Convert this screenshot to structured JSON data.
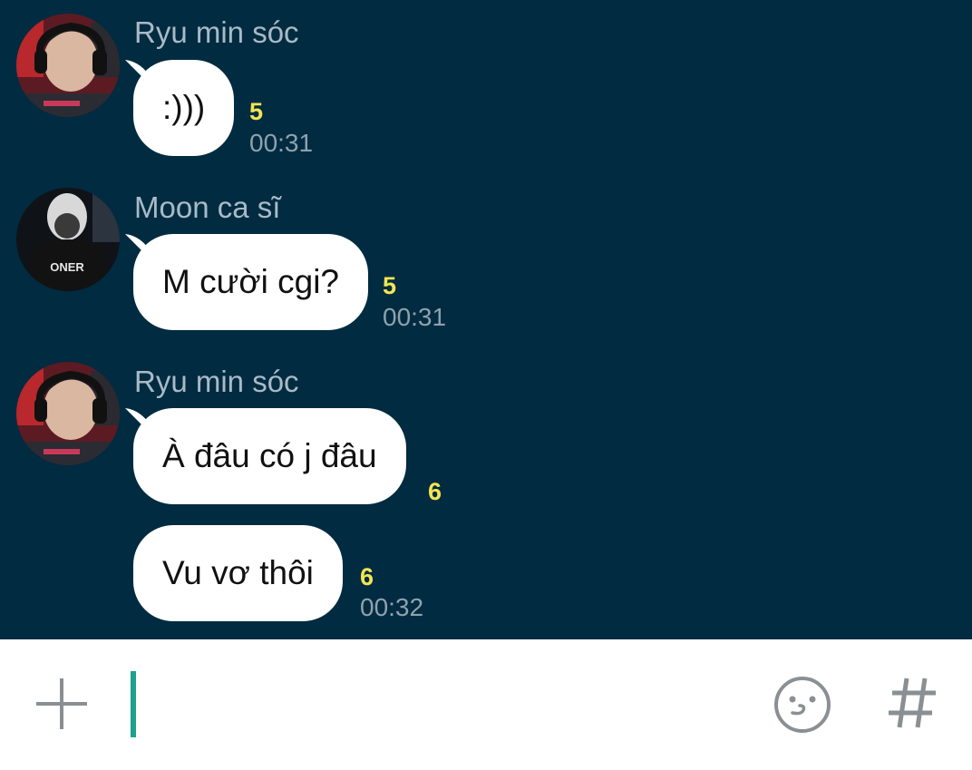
{
  "messages": [
    {
      "sender": "Ryu min sóc",
      "text": ":)))",
      "count": "5",
      "time": "00:31"
    },
    {
      "sender": "Moon ca sĩ",
      "text": "M cười cgi?",
      "count": "5",
      "time": "00:31"
    },
    {
      "sender": "Ryu min sóc",
      "text": "À đâu có j đâu",
      "count": "6",
      "time": ""
    },
    {
      "sender": "",
      "text": "Vu vơ thôi",
      "count": "6",
      "time": "00:32"
    }
  ],
  "avatars": {
    "m1": {
      "jersey_text": ""
    },
    "m2": {
      "jersey_text": "ONER"
    }
  },
  "composer": {
    "plus_icon": "plus-icon",
    "emoji_icon": "emoji-icon",
    "hashtag_icon": "hashtag-icon"
  },
  "colors": {
    "chat_background": "#002b40",
    "bubble": "#ffffff",
    "read_count": "#f2e553",
    "cursor": "#1aa38a"
  }
}
